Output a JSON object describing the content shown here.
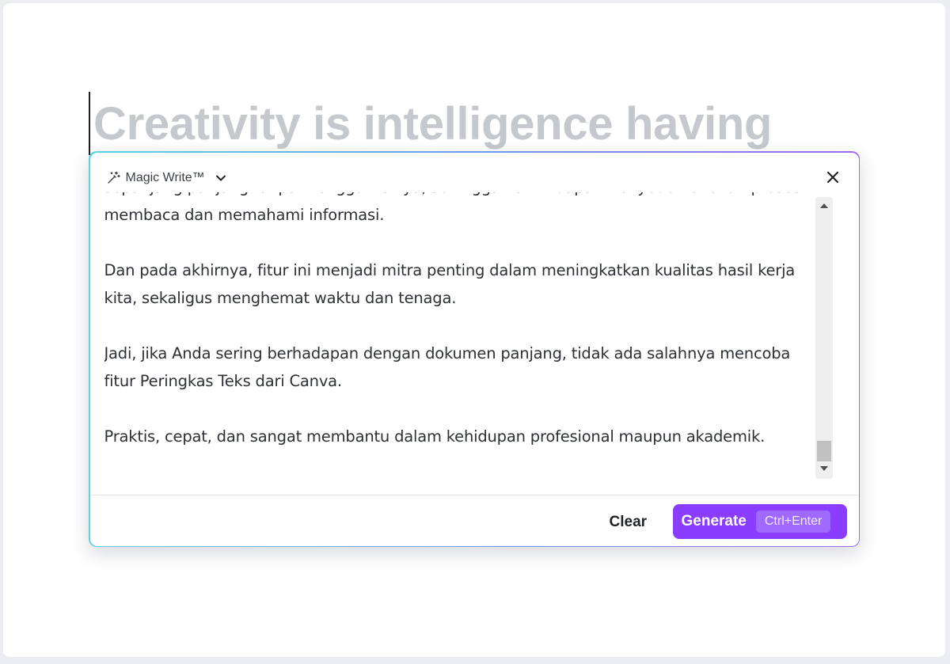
{
  "document": {
    "heading": "Creativity is intelligence having"
  },
  "magic_write": {
    "title": "Magic Write™",
    "icon": "magic-wand-icon",
    "chevron_icon": "chevron-down-icon",
    "close_icon": "close-icon",
    "paragraphs": [
      "sepanjang panjang tanpa menggali isinya, sehingga hal ini dapat menyederhanakan proses membaca dan memahami informasi.",
      "Dan pada akhirnya, fitur ini menjadi mitra penting dalam meningkatkan kualitas hasil kerja kita, sekaligus menghemat waktu dan tenaga.",
      "Jadi, jika Anda sering berhadapan dengan dokumen panjang, tidak ada salahnya mencoba fitur Peringkas Teks dari Canva.",
      "Praktis, cepat, dan sangat membantu dalam kehidupan profesional maupun akademik."
    ],
    "scroll_position": 0.92,
    "clear_label": "Clear",
    "generate_label": "Generate",
    "generate_shortcut": "Ctrl+Enter"
  },
  "colors": {
    "accent": "#8b3dff",
    "heading_text": "#c5c9ce",
    "border_gradient": [
      "#5ed2e0",
      "#6c9cf0",
      "#9a6bef"
    ]
  }
}
